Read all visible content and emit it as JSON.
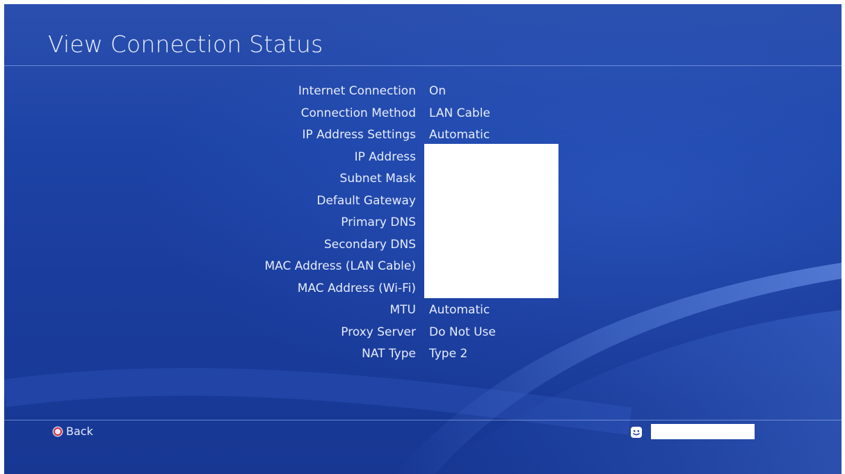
{
  "page": {
    "title": "View Connection Status"
  },
  "status": {
    "rows": [
      {
        "label": "Internet Connection",
        "value": "On"
      },
      {
        "label": "Connection Method",
        "value": "LAN Cable"
      },
      {
        "label": "IP Address Settings",
        "value": "Automatic"
      },
      {
        "label": "IP Address",
        "value": ""
      },
      {
        "label": "Subnet Mask",
        "value": ""
      },
      {
        "label": "Default Gateway",
        "value": ""
      },
      {
        "label": "Primary DNS",
        "value": ""
      },
      {
        "label": "Secondary DNS",
        "value": ""
      },
      {
        "label": "MAC Address (LAN Cable)",
        "value": ""
      },
      {
        "label": "MAC Address (Wi-Fi)",
        "value": ""
      },
      {
        "label": "MTU",
        "value": "Automatic"
      },
      {
        "label": "Proxy Server",
        "value": "Do Not Use"
      },
      {
        "label": "NAT Type",
        "value": "Type 2"
      }
    ]
  },
  "footer": {
    "back_label": "Back",
    "back_icon": "circle-button-icon",
    "user_icon": "user-face-icon",
    "user_name": ""
  },
  "colors": {
    "background": "#1d43a6",
    "text": "#e6ecfb",
    "circle_button": "#d8233a"
  }
}
